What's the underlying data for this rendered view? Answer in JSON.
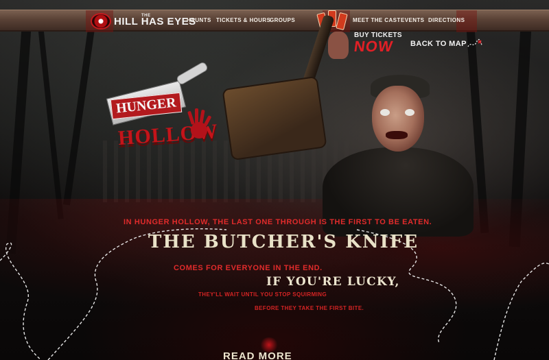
{
  "brand": {
    "the": "THE",
    "name": "HILL HAS EYES"
  },
  "nav": {
    "left": [
      {
        "label": "HAUNTS"
      },
      {
        "label": "TICKETS & HOURS"
      },
      {
        "label": "GROUPS"
      }
    ],
    "right": [
      {
        "label": "MEET THE CAST"
      },
      {
        "label": "EVENTS"
      },
      {
        "label": "DIRECTIONS"
      }
    ]
  },
  "cta": {
    "buy_top": "BUY TICKETS",
    "buy_now": "NOW",
    "back_to_map": "BACK TO MAP"
  },
  "attraction": {
    "word1": "HUNGER",
    "word2": "HOLLOW"
  },
  "tagline": {
    "line1": "In Hunger Hollow, the last one through is the first to be eaten.",
    "line2": "The Butcher's Knife",
    "line3": "comes for everyone in the end.",
    "line4": "If you're lucky,",
    "line5": "they'll wait until you stop squirming",
    "line6": "before they take the first bite."
  },
  "read_more": "READ MORE",
  "colors": {
    "accent_red": "#e02026",
    "cream_text": "#e9e2c8",
    "nav_wood": "#5a4236",
    "background": "#0b0909"
  }
}
